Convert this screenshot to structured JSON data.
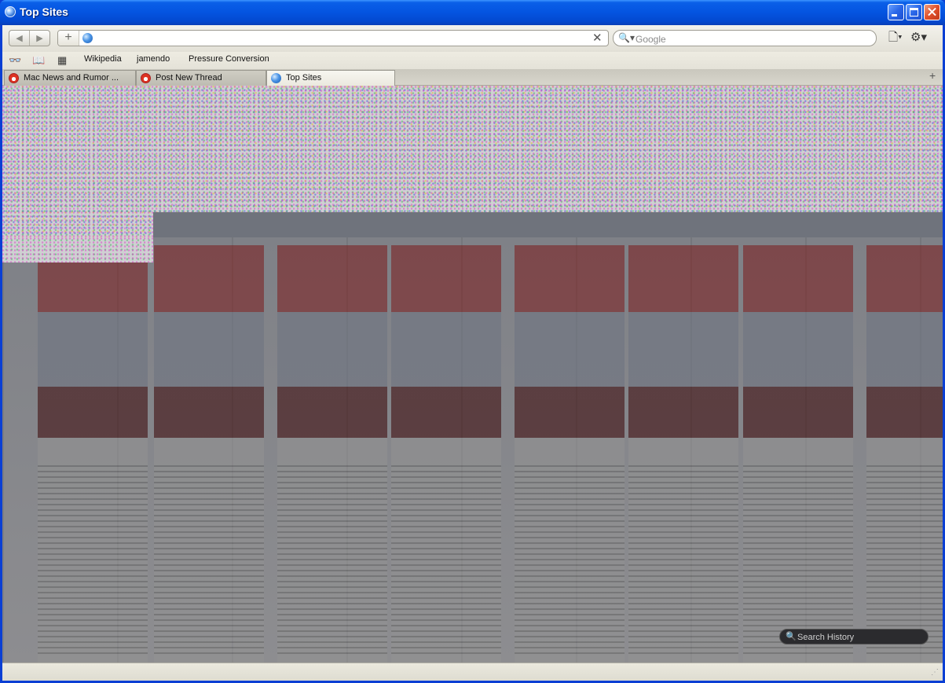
{
  "window": {
    "title": "Top Sites"
  },
  "toolbar": {
    "back_glyph": "◀",
    "forward_glyph": "▶",
    "add_glyph": "+",
    "url_value": "",
    "clear_glyph": "✕",
    "search_placeholder": "Google",
    "search_glyph": "🔍▾",
    "page_menu_glyph": "🗋▾",
    "gear_menu_glyph": "⚙▾"
  },
  "bookmarks": {
    "reader_glyph": "👓",
    "book_glyph": "📖",
    "grid_glyph": "▦",
    "links": [
      "Wikipedia",
      "jamendo",
      "Pressure Conversion"
    ]
  },
  "tabs": [
    {
      "label": "Mac News and Rumor ...",
      "icon": "apple-icon",
      "active": false
    },
    {
      "label": "Post New Thread",
      "icon": "apple-icon",
      "active": false
    },
    {
      "label": "Top Sites",
      "icon": "globe-icon",
      "active": true
    }
  ],
  "tab_add_glyph": "+",
  "content": {
    "search_history_placeholder": "Search History"
  }
}
